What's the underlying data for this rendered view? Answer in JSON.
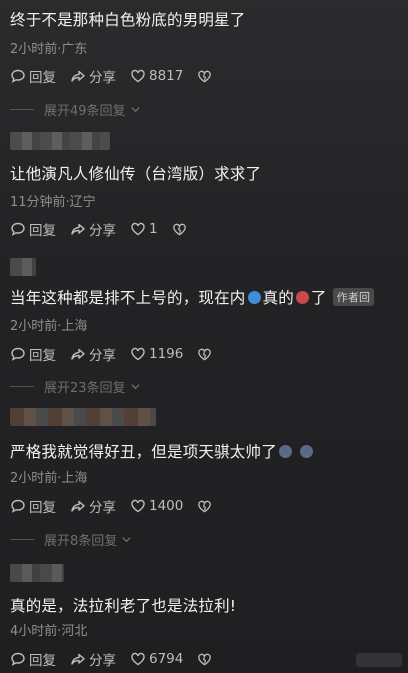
{
  "comments": [
    {
      "text": "终于不是那种白色粉底的男明星了",
      "time": "2小时前·广东",
      "reply_label": "回复",
      "share_label": "分享",
      "likes": "8817"
    },
    {
      "text": "让他演凡人修仙传（台湾版）求求了",
      "time": "11分钟前·辽宁",
      "reply_label": "回复",
      "share_label": "分享",
      "likes": "1"
    },
    {
      "text_a": "当年这种都是排不上号的，现在内",
      "text_b": "真的",
      "text_c": "了",
      "author_tag": "作者回",
      "time": "2小时前·上海",
      "reply_label": "回复",
      "share_label": "分享",
      "likes": "1196"
    },
    {
      "text": "严格我就觉得好丑，但是项天骐太帅了",
      "time": "2小时前·上海",
      "reply_label": "回复",
      "share_label": "分享",
      "likes": "1400"
    },
    {
      "text": "真的是，法拉利老了也是法拉利!",
      "time": "4小时前·河北",
      "reply_label": "回复",
      "share_label": "分享",
      "likes": "6794"
    }
  ],
  "expands": [
    {
      "label": "展开49条回复"
    },
    {
      "label": "展开23条回复"
    },
    {
      "label": "展开8条回复"
    }
  ],
  "icons": {
    "reply": "reply-bubble-icon",
    "share": "share-arrow-icon",
    "like": "heart-icon",
    "dislike": "broken-heart-icon",
    "expand": "chevron-down-icon"
  }
}
